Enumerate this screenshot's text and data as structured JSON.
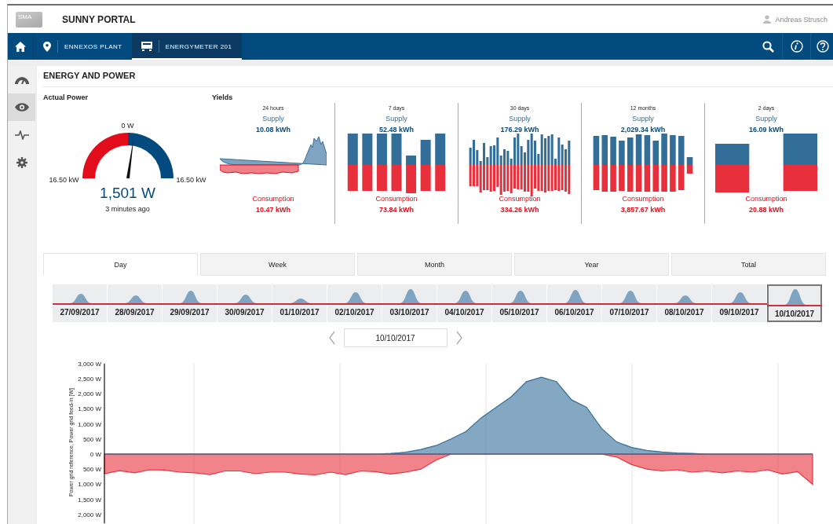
{
  "header": {
    "logo": "SMA",
    "title": "SUNNY PORTAL",
    "user": "Andreas Strusch"
  },
  "breadcrumbs": [
    {
      "kind": "plant",
      "label": "ENNEXOS PLANT",
      "selected": false
    },
    {
      "kind": "meter",
      "label": "ENERGYMETER 201",
      "selected": true
    }
  ],
  "sidebar": {
    "items": [
      {
        "kind": "gauge",
        "selected": false
      },
      {
        "kind": "eye",
        "selected": true
      },
      {
        "kind": "pulse",
        "selected": false
      },
      {
        "kind": "gear",
        "selected": false
      }
    ]
  },
  "page_title": "ENERGY AND POWER",
  "actual_power": {
    "heading": "Actual Power",
    "zero_label": "0 W",
    "min_label": "16.50 kW",
    "max_label": "16.50 kW",
    "value": "1,501 W",
    "updated": "3 minutes ago"
  },
  "yields": {
    "heading": "Yields",
    "cards": [
      {
        "period": "24 hours",
        "supply_label": "Supply",
        "supply": "10.08 kWh",
        "kind": "area",
        "consumption_label": "Consumption",
        "consumption": "10.47 kWh"
      },
      {
        "period": "7 days",
        "supply_label": "Supply",
        "supply": "52.48 kWh",
        "kind": "bars",
        "consumption_label": "Consumption",
        "consumption": "73.84 kWh"
      },
      {
        "period": "30 days",
        "supply_label": "Supply",
        "supply": "176.29 kWh",
        "kind": "bars",
        "consumption_label": "Consumption",
        "consumption": "334.26 kWh"
      },
      {
        "period": "12 months",
        "supply_label": "Supply",
        "supply": "2,029.34 kWh",
        "kind": "bars",
        "consumption_label": "Consumption",
        "consumption": "3,857.67 kWh"
      },
      {
        "period": "2 days",
        "supply_label": "Supply",
        "supply": "16.09 kWh",
        "kind": "bars",
        "consumption_label": "Consumption",
        "consumption": "20.88 kWh"
      }
    ]
  },
  "tabs": [
    {
      "label": "Day",
      "selected": true
    },
    {
      "label": "Week",
      "selected": false
    },
    {
      "label": "Month",
      "selected": false
    },
    {
      "label": "Year",
      "selected": false
    },
    {
      "label": "Total",
      "selected": false
    }
  ],
  "days": [
    {
      "date": "27/09/2017",
      "selected": false
    },
    {
      "date": "28/09/2017",
      "selected": false
    },
    {
      "date": "29/09/2017",
      "selected": false
    },
    {
      "date": "30/09/2017",
      "selected": false
    },
    {
      "date": "01/10/2017",
      "selected": false
    },
    {
      "date": "02/10/2017",
      "selected": false
    },
    {
      "date": "03/10/2017",
      "selected": false
    },
    {
      "date": "04/10/2017",
      "selected": false
    },
    {
      "date": "05/10/2017",
      "selected": false
    },
    {
      "date": "06/10/2017",
      "selected": false
    },
    {
      "date": "07/10/2017",
      "selected": false
    },
    {
      "date": "08/10/2017",
      "selected": false
    },
    {
      "date": "09/10/2017",
      "selected": false
    },
    {
      "date": "10/10/2017",
      "selected": true
    }
  ],
  "date_picker": {
    "value": "10/10/2017"
  },
  "chart": {
    "chart_data": {
      "type": "area",
      "ylabel": "Power grid reference, Power grid feed-in [W]",
      "ylim": [
        -2300,
        3000
      ],
      "yticks": [
        {
          "value": 3000,
          "label": "3,000 W"
        },
        {
          "value": 2500,
          "label": "2,500 W"
        },
        {
          "value": 2000,
          "label": "2,000 W"
        },
        {
          "value": 1500,
          "label": "1,500 W"
        },
        {
          "value": 1000,
          "label": "1,000 W"
        },
        {
          "value": 500,
          "label": "500 W"
        },
        {
          "value": 0,
          "label": "0 W"
        },
        {
          "value": -500,
          "label": "500 W"
        },
        {
          "value": -1000,
          "label": "1,000 W"
        },
        {
          "value": -1500,
          "label": "1,500 W"
        },
        {
          "value": -2000,
          "label": "2,000 W"
        }
      ],
      "series": [
        {
          "color": "#336e99",
          "values": [
            0,
            0,
            0,
            0,
            0,
            0,
            0,
            0,
            0,
            0,
            0,
            0,
            0,
            0,
            0,
            0,
            0,
            0,
            0,
            20,
            60,
            150,
            280,
            500,
            750,
            1200,
            1550,
            1900,
            2400,
            2550,
            2400,
            1800,
            1550,
            850,
            400,
            220,
            120,
            70,
            40,
            20,
            0,
            0,
            0,
            0,
            0,
            0,
            0,
            0
          ]
        },
        {
          "color": "#e8303c",
          "values": [
            -650,
            -550,
            -620,
            -520,
            -530,
            -600,
            -620,
            -680,
            -560,
            -560,
            -650,
            -600,
            -600,
            -660,
            -690,
            -600,
            -680,
            -560,
            -580,
            -660,
            -600,
            -500,
            -200,
            0,
            0,
            0,
            0,
            0,
            0,
            0,
            0,
            0,
            0,
            0,
            -100,
            -350,
            -500,
            -560,
            -520,
            -600,
            -560,
            -620,
            -560,
            -600,
            -520,
            -660,
            -580,
            -1000
          ]
        }
      ]
    }
  }
}
